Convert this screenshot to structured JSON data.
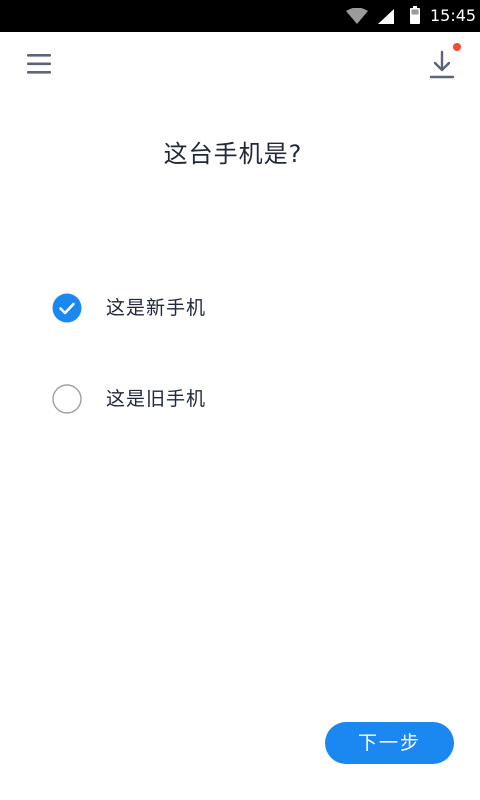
{
  "status_bar": {
    "time": "15:45",
    "icons": [
      "wifi-icon",
      "signal-icon",
      "battery-icon"
    ]
  },
  "toolbar": {
    "menu_icon": "menu-icon",
    "download_icon": "download-icon",
    "has_notification": true
  },
  "question": {
    "title": "这台手机是?"
  },
  "options": [
    {
      "label": "这是新手机",
      "selected": true
    },
    {
      "label": "这是旧手机",
      "selected": false
    }
  ],
  "actions": {
    "next_label": "下一步"
  },
  "colors": {
    "accent": "#1a88f0",
    "notification": "#f04b36",
    "text": "#20283a",
    "icon": "#5b6478",
    "radio_border": "#9aa0ac"
  }
}
